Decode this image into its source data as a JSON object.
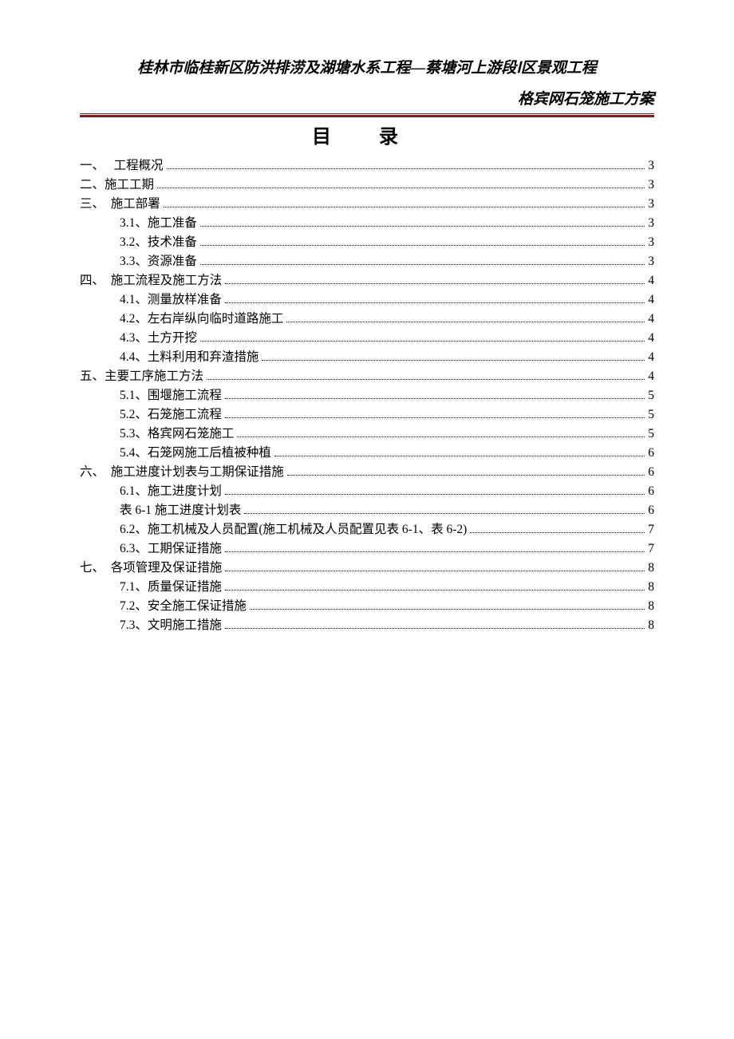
{
  "header": {
    "title": "桂林市临桂新区防洪排涝及湖塘水系工程—蔡塘河上游段Ⅰ区景观工程",
    "subtitle": "格宾网石笼施工方案"
  },
  "toc": {
    "title": "目录",
    "entries": [
      {
        "label": "一、   工程概况",
        "page": "3",
        "indent": 0
      },
      {
        "label": "二、施工工期",
        "page": "3",
        "indent": 0
      },
      {
        "label": "三、  施工部署",
        "page": "3",
        "indent": 0
      },
      {
        "label": "3.1、施工准备",
        "page": "3",
        "indent": 1
      },
      {
        "label": "3.2、技术准备",
        "page": "3",
        "indent": 1
      },
      {
        "label": "3.3、资源准备",
        "page": "3",
        "indent": 1
      },
      {
        "label": "四、  施工流程及施工方法",
        "page": "4",
        "indent": 0
      },
      {
        "label": "4.1、测量放样准备",
        "page": "4",
        "indent": 1
      },
      {
        "label": "4.2、左右岸纵向临时道路施工",
        "page": "4",
        "indent": 1
      },
      {
        "label": "4.3、土方开挖",
        "page": "4",
        "indent": 1
      },
      {
        "label": "4.4、土料利用和弃渣措施",
        "page": "4",
        "indent": 1
      },
      {
        "label": "五、主要工序施工方法",
        "page": "4",
        "indent": 0
      },
      {
        "label": "5.1、围堰施工流程",
        "page": "5",
        "indent": 1
      },
      {
        "label": "5.2、石笼施工流程",
        "page": "5",
        "indent": 1
      },
      {
        "label": "5.3、格宾网石笼施工",
        "page": "5",
        "indent": 1
      },
      {
        "label": "5.4、石笼网施工后植被种植",
        "page": "6",
        "indent": 1
      },
      {
        "label": "六、  施工进度计划表与工期保证措施",
        "page": "6",
        "indent": 0
      },
      {
        "label": "6.1、施工进度计划",
        "page": "6",
        "indent": 1
      },
      {
        "label": "表 6-1 施工进度计划表",
        "page": "6",
        "indent": 1
      },
      {
        "label": "6.2、施工机械及人员配置(施工机械及人员配置见表 6-1、表 6-2)",
        "page": "7",
        "indent": 1
      },
      {
        "label": "6.3、工期保证措施",
        "page": "7",
        "indent": 1
      },
      {
        "label": "七、  各项管理及保证措施",
        "page": "8",
        "indent": 0
      },
      {
        "label": "7.1、质量保证措施",
        "page": "8",
        "indent": 1
      },
      {
        "label": "7.2、安全施工保证措施",
        "page": "8",
        "indent": 1
      },
      {
        "label": "7.3、文明施工措施",
        "page": "8",
        "indent": 1
      }
    ]
  }
}
